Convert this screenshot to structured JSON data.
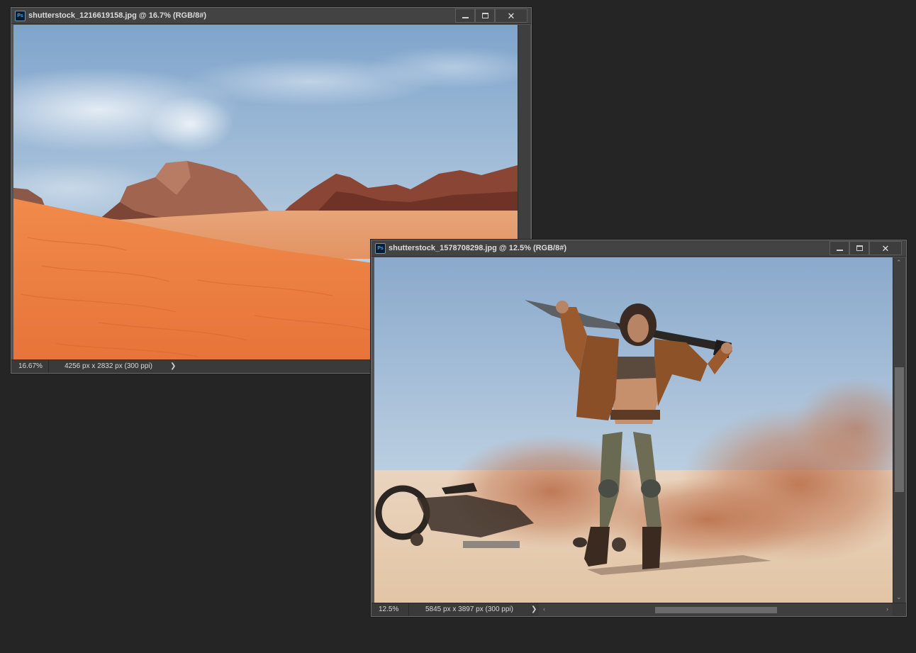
{
  "window1": {
    "title": "shutterstock_1216619158.jpg @ 16.7% (RGB/8#)",
    "zoom": "16.67%",
    "doc_info": "4256 px x 2832 px (300 ppi)",
    "status_arrow": "❯",
    "image_subject": "desert dunes with rock formations"
  },
  "window2": {
    "title": "shutterstock_1578708298.jpg @ 12.5% (RGB/8#)",
    "zoom": "12.5%",
    "doc_info": "5845 px x 3897 px (300 ppi)",
    "status_arrow": "❯",
    "image_subject": "woman warrior holding sword in desert with smoke"
  },
  "window_controls": {
    "minimize": "minimize-icon",
    "maximize": "maximize-icon",
    "close": "✕"
  },
  "colors": {
    "workspace": "#252525",
    "titlebar": "#434343",
    "statusbar": "#3a3a3a",
    "ps_blue": "#31a8ff"
  }
}
